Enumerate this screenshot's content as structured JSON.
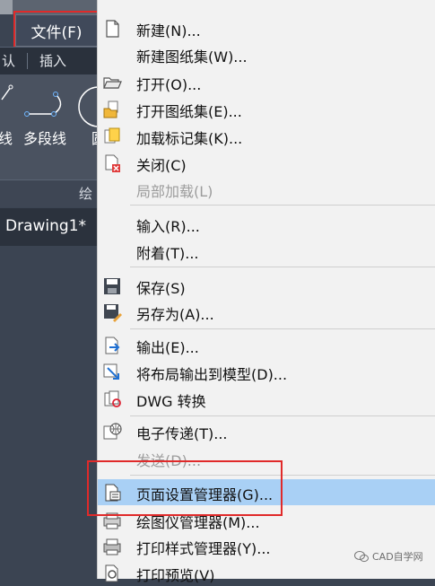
{
  "ribbon": {
    "file_tab": "文件(F)",
    "tab_left": "认",
    "tab_insert": "插入",
    "tool_left": "线",
    "tool_polyline": "多段线",
    "tool_right": "圆",
    "panel_label": "绘",
    "drawing_tab": "Drawing1*"
  },
  "menu": {
    "items": [
      {
        "label": "新建(N)...",
        "icon": "new-file-icon",
        "enabled": true
      },
      {
        "label": "新建图纸集(W)...",
        "icon": "none",
        "enabled": true
      },
      {
        "label": "打开(O)...",
        "icon": "open-folder-icon",
        "enabled": true
      },
      {
        "label": "打开图纸集(E)...",
        "icon": "open-sheetset-icon",
        "enabled": true
      },
      {
        "label": "加载标记集(K)...",
        "icon": "markup-set-icon",
        "enabled": true
      },
      {
        "label": "关闭(C)",
        "icon": "close-doc-icon",
        "enabled": true
      },
      {
        "label": "局部加载(L)",
        "icon": "none",
        "enabled": false
      },
      {
        "label": "输入(R)...",
        "icon": "none",
        "enabled": true
      },
      {
        "label": "附着(T)...",
        "icon": "none",
        "enabled": true
      },
      {
        "label": "保存(S)",
        "icon": "save-icon",
        "enabled": true
      },
      {
        "label": "另存为(A)...",
        "icon": "save-as-icon",
        "enabled": true
      },
      {
        "label": "输出(E)...",
        "icon": "export-icon",
        "enabled": true
      },
      {
        "label": "将布局输出到模型(D)...",
        "icon": "layout-to-model-icon",
        "enabled": true
      },
      {
        "label": "DWG 转换",
        "icon": "dwg-convert-icon",
        "enabled": true
      },
      {
        "label": "电子传递(T)...",
        "icon": "etransmit-icon",
        "enabled": true
      },
      {
        "label": "发送(D)...",
        "icon": "none",
        "enabled": false
      },
      {
        "label": "页面设置管理器(G)...",
        "icon": "page-setup-icon",
        "enabled": true,
        "highlighted": true
      },
      {
        "label": "绘图仪管理器(M)...",
        "icon": "plotter-manager-icon",
        "enabled": true
      },
      {
        "label": "打印样式管理器(Y)...",
        "icon": "plot-style-icon",
        "enabled": true
      },
      {
        "label": "打印预览(V)",
        "icon": "plot-preview-icon",
        "enabled": true
      }
    ]
  },
  "watermark": {
    "text": "CAD自学网"
  },
  "colors": {
    "menu_bg": "#f2f2f2",
    "menu_hover": "#a9d0f5",
    "highlight_box": "#e02a2a",
    "ribbon_bg": "#4a5260",
    "disabled_text": "#9c9c9c"
  }
}
